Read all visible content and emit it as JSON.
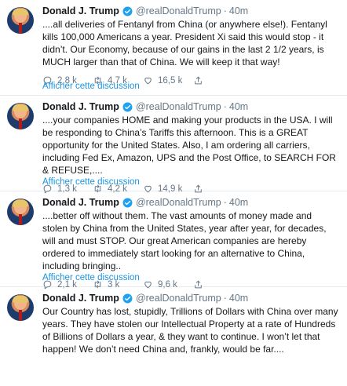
{
  "tweets": [
    {
      "name": "Donald J. Trump",
      "handle": "@realDonaldTrump",
      "separator": "·",
      "time": "40m",
      "text": "....all deliveries of Fentanyl from China (or anywhere else!). Fentanyl kills 100,000 Americans a year. President Xi said this would stop - it didn’t. Our Economy, because of our gains in the last 2 1/2 years, is MUCH larger than that of China. We will keep it that way!",
      "replies": "2,8 k",
      "retweets": "4,7 k",
      "likes": "16,5 k",
      "thread_link": "Afficher cette discussion"
    },
    {
      "name": "Donald J. Trump",
      "handle": "@realDonaldTrump",
      "separator": "·",
      "time": "40m",
      "text": "....your companies HOME and making your products in the USA. I will be responding to China’s Tariffs this afternoon. This is a GREAT opportunity for the United States. Also, I am ordering all carriers, including Fed Ex, Amazon, UPS and the Post Office, to SEARCH FOR & REFUSE,....",
      "replies": "1,3 k",
      "retweets": "4,2 k",
      "likes": "14,9 k",
      "thread_link": "Afficher cette discussion"
    },
    {
      "name": "Donald J. Trump",
      "handle": "@realDonaldTrump",
      "separator": "·",
      "time": "40m",
      "text": "....better off without them. The vast amounts of money made and stolen by China from the United States, year after year, for decades, will and must STOP. Our great American companies are hereby ordered to immediately start looking for an alternative to China, including bringing..",
      "replies": "2,1 k",
      "retweets": "3 k",
      "likes": "9,6 k",
      "thread_link": "Afficher cette discussion"
    },
    {
      "name": "Donald J. Trump",
      "handle": "@realDonaldTrump",
      "separator": "·",
      "time": "40m",
      "text": "Our Country has lost, stupidly, Trillions of Dollars with China over many years. They have stolen our Intellectual Property at a rate of Hundreds of Billions of Dollars a year, & they want to continue. I won’t let that happen! We don’t need China and, frankly, would be far...."
    }
  ],
  "colors": {
    "link": "#1b95e0",
    "muted": "#657786",
    "verified": "#1da1f2",
    "divider": "#e6ecf0"
  },
  "icons": [
    "reply-icon",
    "retweet-icon",
    "like-icon",
    "share-icon",
    "verified-badge-icon"
  ]
}
